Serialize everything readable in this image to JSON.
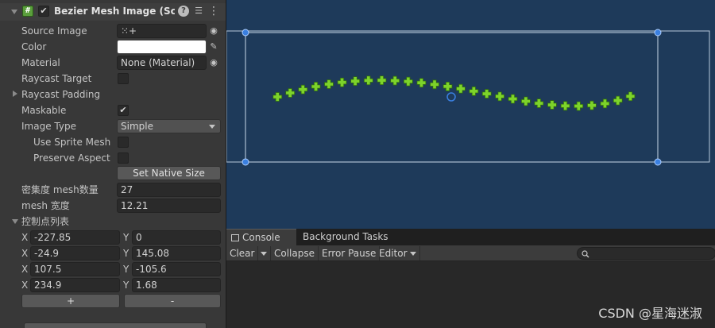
{
  "inspector": {
    "component_title": "Bezier Mesh Image (Scrip",
    "component_enabled": true,
    "properties": {
      "source_image": {
        "label": "Source Image",
        "value": "⁙+"
      },
      "color": {
        "label": "Color",
        "value": "#ffffff"
      },
      "material": {
        "label": "Material",
        "value": "None (Material)"
      },
      "raycast_target": {
        "label": "Raycast Target",
        "checked": false
      },
      "raycast_padding": {
        "label": "Raycast Padding"
      },
      "maskable": {
        "label": "Maskable",
        "checked": true,
        "check_glyph": "✔"
      },
      "image_type": {
        "label": "Image Type",
        "value": "Simple"
      },
      "use_sprite_mesh": {
        "label": "Use Sprite Mesh",
        "checked": false
      },
      "preserve_aspect": {
        "label": "Preserve Aspect",
        "checked": false
      },
      "set_native_size": {
        "label": "Set Native Size"
      },
      "density": {
        "label": "密集度 mesh数量",
        "value": "27"
      },
      "mesh_width": {
        "label": "mesh 宽度",
        "value": "12.21"
      },
      "control_points_label": "控制点列表"
    },
    "control_points": [
      {
        "x": "-227.85",
        "y": "0"
      },
      {
        "x": "-24.9",
        "y": "145.08"
      },
      {
        "x": "107.5",
        "y": "-105.6"
      },
      {
        "x": "234.9",
        "y": "1.68"
      }
    ],
    "axis_x": "X",
    "axis_y": "Y",
    "add_button": "+",
    "remove_button": "-",
    "icons": {
      "script": "hash-icon",
      "help": "help-icon",
      "presets": "sliders-icon",
      "menu": "kebab-icon",
      "object_picker": "target-icon",
      "color_picker": "eyedropper-icon"
    },
    "icon_glyphs": {
      "hash": "#",
      "check": "✔",
      "help": "?",
      "presets": "☰",
      "menu": "⋮",
      "picker": "◉",
      "eyedropper": "✎"
    }
  },
  "scene": {
    "background": "#1e3a5a",
    "rect_color": "#c8d8e8",
    "handle_color": "#3a7fe0",
    "marker_color": "#7dd32a",
    "marker_count": 27
  },
  "console": {
    "tabs": [
      {
        "label": "Console",
        "icon": "console-icon",
        "active": true
      },
      {
        "label": "Background Tasks",
        "active": false
      }
    ],
    "toolbar": {
      "clear": "Clear",
      "collapse": "Collapse",
      "error_pause": "Error Pause",
      "editor": "Editor",
      "search_icon": "search-icon"
    }
  },
  "watermark": "CSDN @星海迷淑"
}
